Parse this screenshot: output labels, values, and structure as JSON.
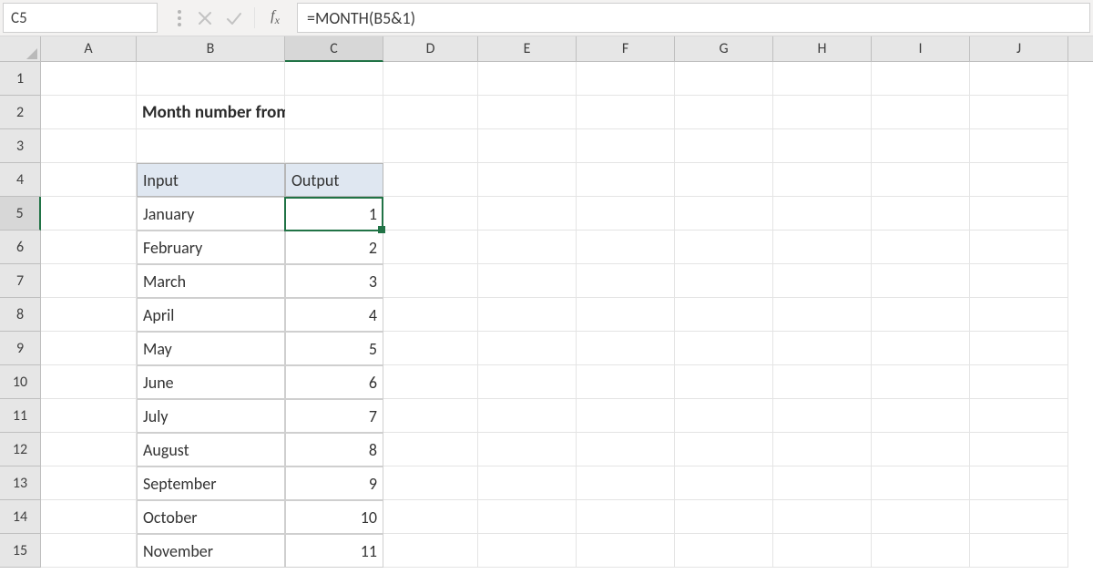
{
  "namebox": {
    "value": "C5"
  },
  "formula": {
    "value": "=MONTH(B5&1)"
  },
  "columns": [
    "A",
    "B",
    "C",
    "D",
    "E",
    "F",
    "G",
    "H",
    "I",
    "J"
  ],
  "rows": [
    "1",
    "2",
    "3",
    "4",
    "5",
    "6",
    "7",
    "8",
    "9",
    "10",
    "11",
    "12",
    "13",
    "14",
    "15"
  ],
  "active": {
    "col": "C",
    "row": 5
  },
  "title": "Month number from name",
  "table": {
    "headers": {
      "input": "Input",
      "output": "Output"
    },
    "rows": [
      {
        "input": "January",
        "output": "1"
      },
      {
        "input": "February",
        "output": "2"
      },
      {
        "input": "March",
        "output": "3"
      },
      {
        "input": "April",
        "output": "4"
      },
      {
        "input": "May",
        "output": "5"
      },
      {
        "input": "June",
        "output": "6"
      },
      {
        "input": "July",
        "output": "7"
      },
      {
        "input": "August",
        "output": "8"
      },
      {
        "input": "September",
        "output": "9"
      },
      {
        "input": "October",
        "output": "10"
      },
      {
        "input": "November",
        "output": "11"
      }
    ]
  }
}
